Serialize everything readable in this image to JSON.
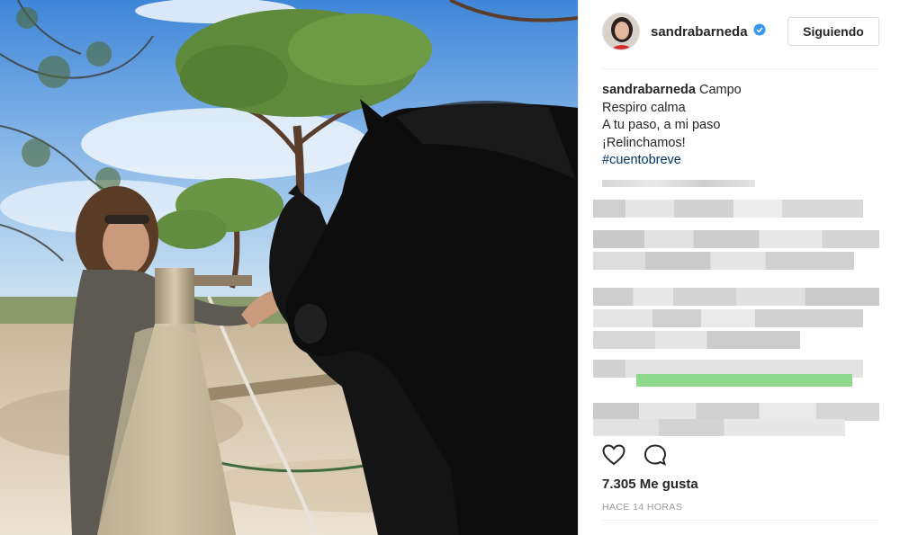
{
  "post": {
    "username": "sandrabarneda",
    "follow_button": "Siguiendo",
    "caption_title": "Campo",
    "caption_lines": [
      "Respiro calma",
      "A tu paso, a mi paso",
      "¡Relinchamos!"
    ],
    "hashtag": "#cuentobreve",
    "likes_text": "7.305 Me gusta",
    "timestamp": "HACE 14 HORAS"
  },
  "icons": {
    "verified": "verified-badge-icon",
    "like": "heart-outline-icon",
    "comment": "comment-bubble-icon"
  },
  "colors": {
    "hashtag": "#003569",
    "verified": "#3897f0",
    "muted": "#999999",
    "pixelated_highlight": "#8fd98f"
  }
}
